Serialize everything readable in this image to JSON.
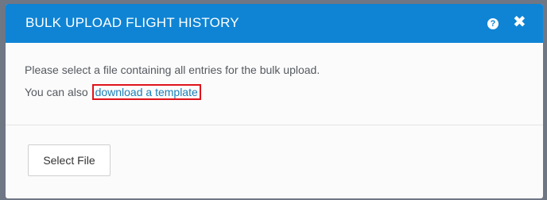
{
  "dialog": {
    "title": "BULK UPLOAD FLIGHT HISTORY",
    "help_glyph": "?",
    "close_glyph": "✖",
    "icons": {
      "help": "help-icon",
      "close": "close-icon"
    }
  },
  "body": {
    "instruction": "Please select a file containing all entries for the bulk upload.",
    "template_prefix": "You can also ",
    "template_link": "download a template"
  },
  "footer": {
    "select_file_label": "Select File"
  },
  "colors": {
    "header_bg": "#0f84d4",
    "link": "#1b7fb7",
    "highlight_border": "#e0131b",
    "backdrop": "#6f7684"
  }
}
